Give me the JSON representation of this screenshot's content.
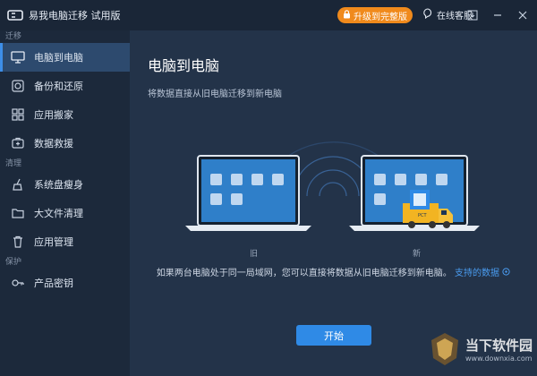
{
  "app": {
    "title": "易我电脑迁移 试用版",
    "upgrade_label": "升级到完整版",
    "support_label": "在线客服"
  },
  "sidebar": {
    "sections": [
      {
        "label": "迁移",
        "items": [
          {
            "label": "电脑到电脑",
            "icon": "monitor-icon",
            "active": true
          },
          {
            "label": "备份和还原",
            "icon": "backup-icon"
          },
          {
            "label": "应用搬家",
            "icon": "apps-icon"
          },
          {
            "label": "数据救援",
            "icon": "rescue-icon"
          }
        ]
      },
      {
        "label": "清理",
        "items": [
          {
            "label": "系统盘瘦身",
            "icon": "broom-icon"
          },
          {
            "label": "大文件清理",
            "icon": "folder-icon"
          },
          {
            "label": "应用管理",
            "icon": "trash-icon"
          }
        ]
      },
      {
        "label": "保护",
        "items": [
          {
            "label": "产品密钥",
            "icon": "key-icon"
          }
        ]
      }
    ]
  },
  "main": {
    "title": "电脑到电脑",
    "subtitle": "将数据直接从旧电脑迁移到新电脑",
    "old_label": "旧",
    "new_label": "新",
    "info_text": "如果两台电脑处于同一局域网，您可以直接将数据从旧电脑迁移到新电脑。",
    "info_link": "支持的数据",
    "start_label": "开始",
    "truck_label": "PCT"
  },
  "watermark": {
    "name": "当下软件园",
    "url": "www.downxia.com"
  },
  "colors": {
    "accent": "#2f8ae6",
    "upgrade": "#f08a1c",
    "sidebar_active": "#2d4a6e",
    "background": "#233349"
  }
}
